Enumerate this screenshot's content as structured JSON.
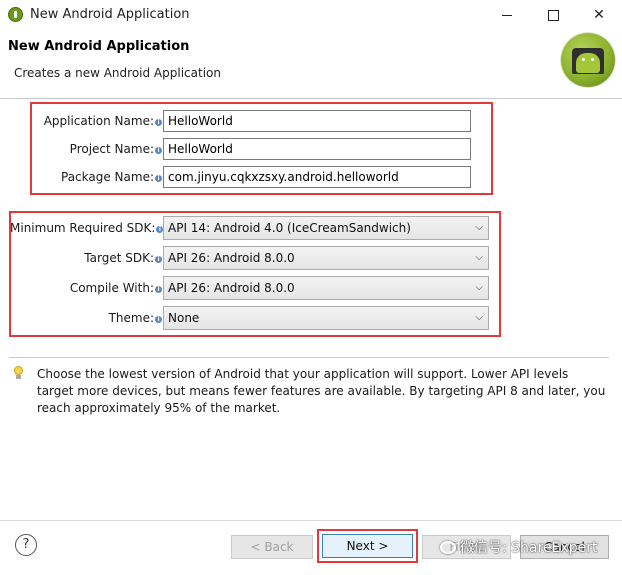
{
  "window": {
    "title": "New Android Application",
    "controls": {
      "minimize": "minimize",
      "maximize": "maximize",
      "close": "✕"
    }
  },
  "header": {
    "title": "New Android Application",
    "subtitle": "Creates a new Android Application",
    "logo_icon": "android-logo-icon"
  },
  "form": {
    "application_name": {
      "label": "Application Name:",
      "value": "HelloWorld"
    },
    "project_name": {
      "label": "Project Name:",
      "value": "HelloWorld"
    },
    "package_name": {
      "label": "Package Name:",
      "value": "com.jinyu.cqkxzsxy.android.helloworld"
    },
    "min_sdk": {
      "label": "Minimum Required SDK:",
      "value": "API 14: Android 4.0 (IceCreamSandwich)"
    },
    "target_sdk": {
      "label": "Target SDK:",
      "value": "API 26: Android 8.0.0"
    },
    "compile_with": {
      "label": "Compile With:",
      "value": "API 26: Android 8.0.0"
    },
    "theme": {
      "label": "Theme:",
      "value": "None"
    },
    "info_glyph": "i"
  },
  "hint": {
    "icon": "lightbulb-icon",
    "text": "Choose the lowest version of Android that your application will support. Lower API levels target more devices, but means fewer features are available. By targeting API 8 and later, you reach approximately 95% of the market."
  },
  "footer": {
    "help": "?",
    "back": "< Back",
    "next": "Next >",
    "finish": "Finish",
    "cancel": "Cancel",
    "watermark": "微信号: ShareExpert"
  },
  "colors": {
    "highlight_border": "#e0393e",
    "next_button_border": "#3c7fb1",
    "android_green": "#a4c639"
  }
}
